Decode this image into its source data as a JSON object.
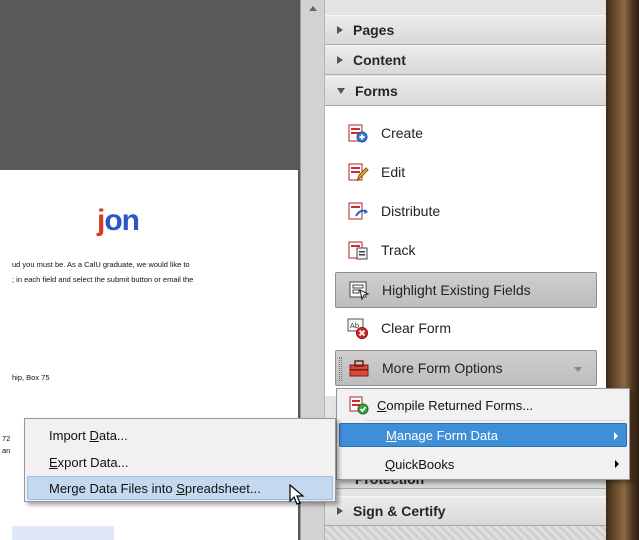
{
  "document": {
    "heading_main": "j",
    "heading_accent": "on",
    "lines": [
      "ud you must be.  As a CalU graduate, we would like to",
      "; in each field and select the submit button or email the",
      "hip, Box 75",
      "72",
      "an"
    ]
  },
  "panel": {
    "sections": {
      "pages": "Pages",
      "content": "Content",
      "forms": "Forms",
      "protection": "Protection",
      "sign_certify": "Sign & Certify"
    },
    "forms_tools": {
      "create": "Create",
      "edit": "Edit",
      "distribute": "Distribute",
      "track": "Track",
      "highlight": "Highlight Existing Fields",
      "clear": "Clear Form",
      "more": "More Form Options"
    }
  },
  "more_options_menu": {
    "compile_prefix": "",
    "compile_key": "C",
    "compile_suffix": "ompile Returned Forms...",
    "manage_prefix": "",
    "manage_key": "M",
    "manage_suffix": "anage Form Data",
    "quickbooks_prefix": "",
    "quickbooks_key": "Q",
    "quickbooks_suffix": "uickBooks"
  },
  "manage_data_menu": {
    "import_prefix": "Import ",
    "import_key": "D",
    "import_suffix": "ata...",
    "export_prefix": "",
    "export_key": "E",
    "export_suffix": "xport Data...",
    "merge_prefix": "Merge Data Files into ",
    "merge_key": "S",
    "merge_suffix": "preadsheet..."
  },
  "colors": {
    "menu_highlight": "#c4d8ee",
    "submenu_parent_highlight": "#3e8fd8",
    "heading_blue": "#2a56c6",
    "heading_red": "#d63b2a"
  },
  "icons": {
    "create": "form-create-icon",
    "edit": "form-edit-icon",
    "distribute": "form-distribute-icon",
    "track": "form-track-icon",
    "highlight": "highlight-fields-icon",
    "clear": "clear-form-icon",
    "more": "toolbox-icon",
    "compile": "compile-forms-icon"
  }
}
